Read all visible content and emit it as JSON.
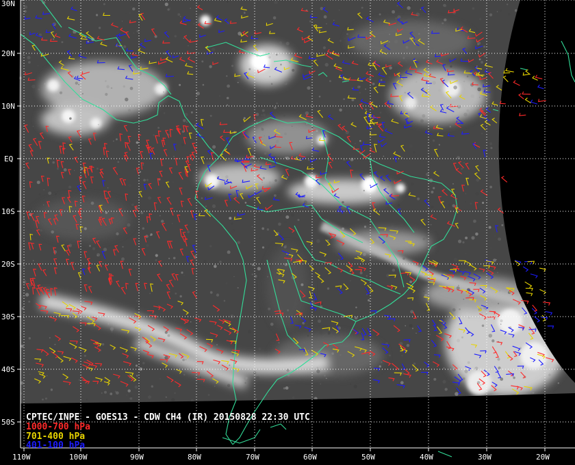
{
  "title": "CPTEC/INPE - GOES13 - CDW CH4 (IR) 20150828 22:30 UTC",
  "legend": [
    {
      "label": "1000-700 hPa",
      "color": "#ff2a2a"
    },
    {
      "label": "701-400 hPa",
      "color": "#e8d400"
    },
    {
      "label": "401-100 hPa",
      "color": "#1c1cff"
    }
  ],
  "lat_labels": [
    "30N",
    "20N",
    "10N",
    "EQ",
    "10S",
    "20S",
    "30S",
    "40S",
    "50S"
  ],
  "lon_labels": [
    "110W",
    "100W",
    "90W",
    "80W",
    "70W",
    "60W",
    "50W",
    "40W",
    "30W",
    "20W"
  ],
  "colors": {
    "background": "#000000",
    "coastline": "#33dd99",
    "grid": "#ffffff",
    "cloud": "#e8e8e8",
    "ocean": "#474747"
  }
}
